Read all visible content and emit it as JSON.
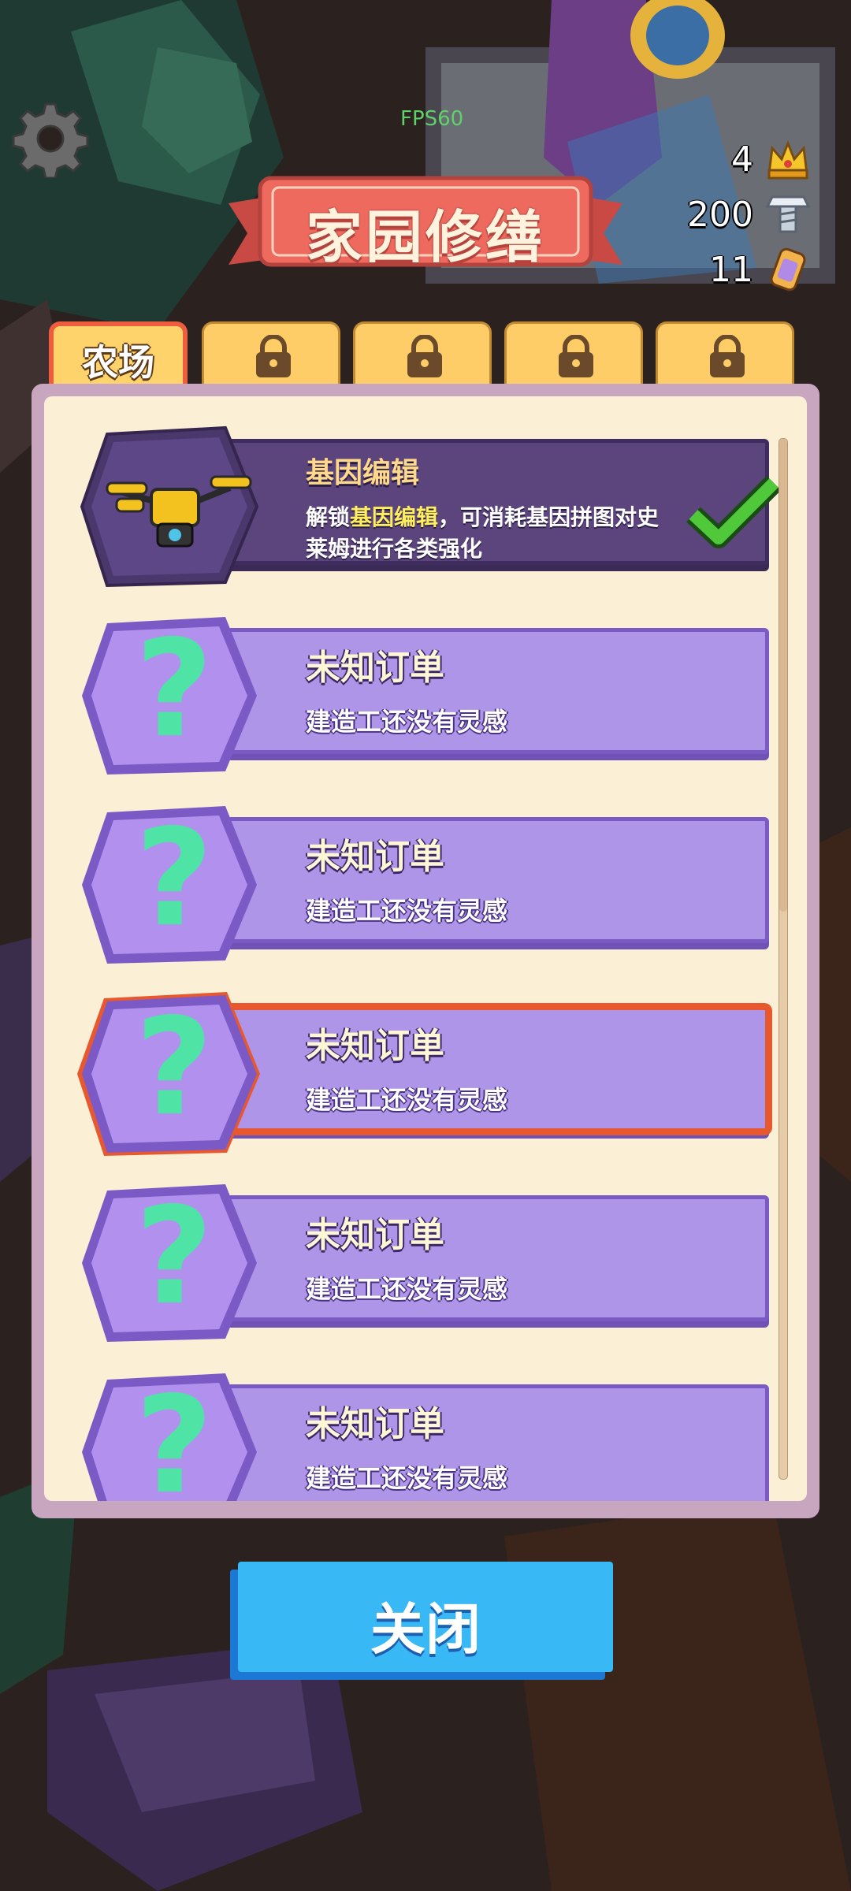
{
  "hud": {
    "fps": "FPS60",
    "crowns": "4",
    "bolts": "200",
    "potions": "11"
  },
  "title": "家园修缮",
  "tabs": [
    {
      "label": "农场",
      "active": true
    },
    {
      "label": "",
      "locked": true
    },
    {
      "label": "",
      "locked": true
    },
    {
      "label": "",
      "locked": true
    },
    {
      "label": "",
      "locked": true
    }
  ],
  "cards": [
    {
      "name": "基因编辑",
      "desc_pre": "解锁",
      "desc_highlight": "基因编辑",
      "desc_post": "，可消耗基因拼图对史莱姆进行各类强化",
      "status": "completed",
      "icon": "drone-icon"
    },
    {
      "name": "未知订单",
      "desc": "建造工还没有灵感",
      "status": "unknown"
    },
    {
      "name": "未知订单",
      "desc": "建造工还没有灵感",
      "status": "unknown"
    },
    {
      "name": "未知订单",
      "desc": "建造工还没有灵感",
      "status": "unknown",
      "selected": true
    },
    {
      "name": "未知订单",
      "desc": "建造工还没有灵感",
      "status": "unknown"
    },
    {
      "name": "未知订单",
      "desc": "建造工还没有灵感",
      "status": "unknown"
    }
  ],
  "close_label": "关闭",
  "colors": {
    "accent_orange": "#e8582f",
    "question_green": "#4fe3a6",
    "card_purple": "#ae95e8",
    "button_blue": "#38b9f5"
  }
}
